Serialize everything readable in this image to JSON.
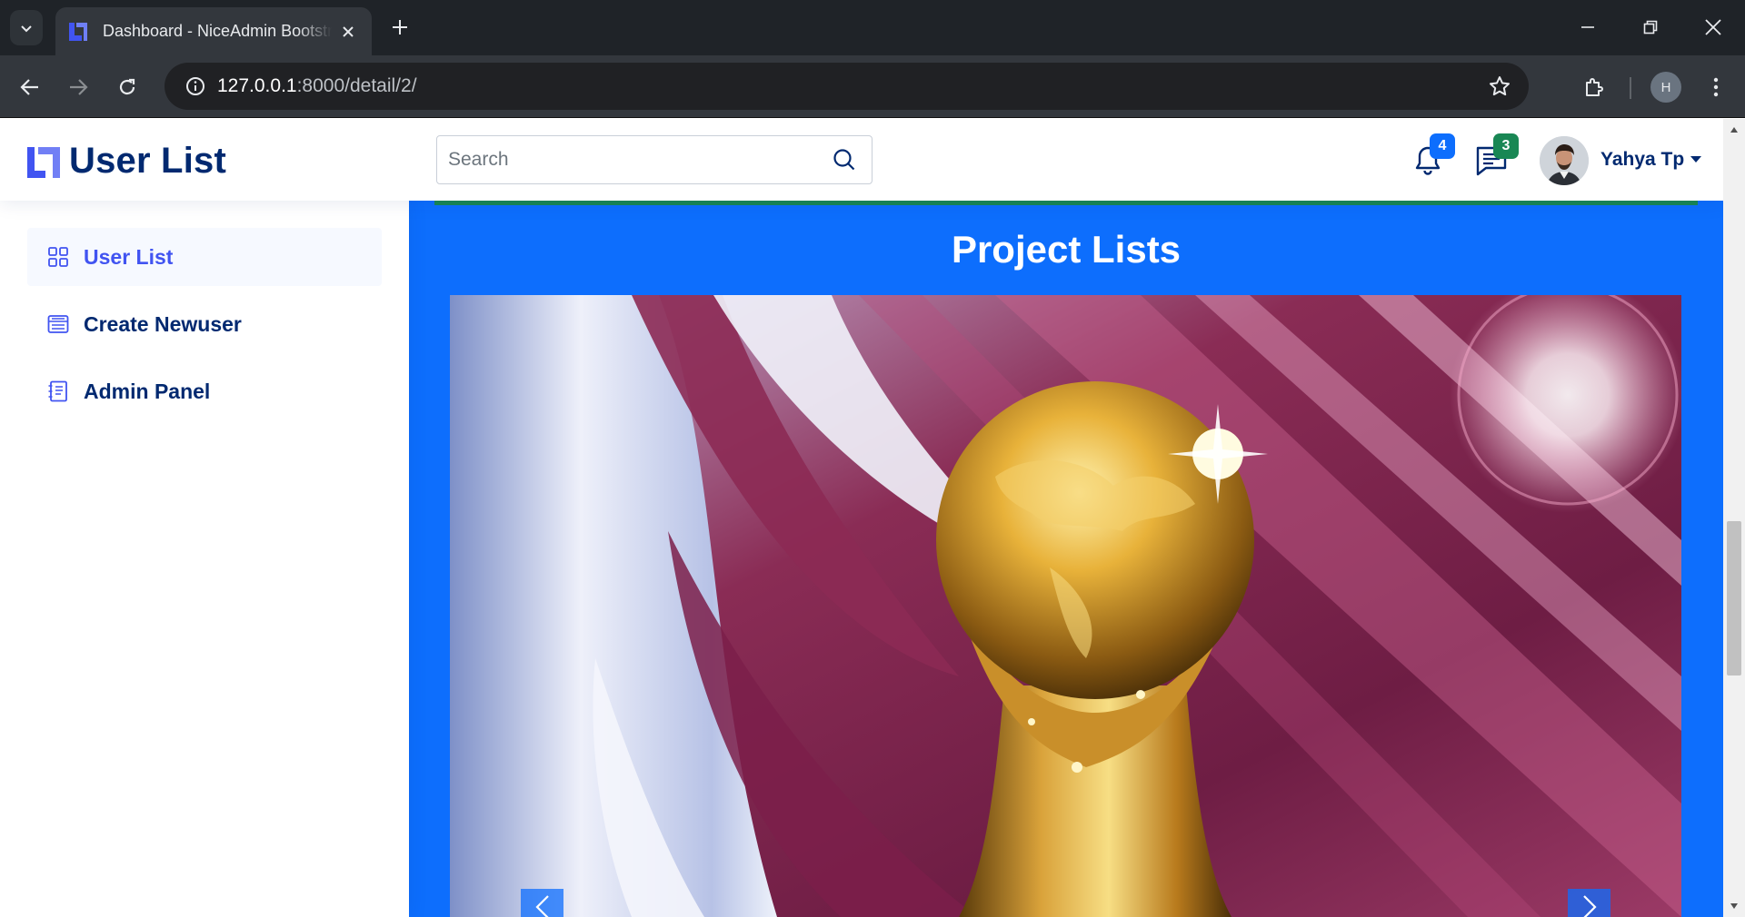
{
  "browser": {
    "tab_title": "Dashboard - NiceAdmin Bootstrap Template",
    "url_host": "127.0.0.1",
    "url_path": ":8000/detail/2/",
    "profile_initial": "H"
  },
  "header": {
    "logo_text": "User List",
    "search_placeholder": "Search",
    "notifications_count": "4",
    "messages_count": "3",
    "profile_name": "Yahya Tp"
  },
  "sidebar": {
    "items": [
      {
        "label": "User List",
        "icon": "grid-icon",
        "active": true
      },
      {
        "label": "Create Newuser",
        "icon": "menu-button-icon",
        "active": false
      },
      {
        "label": "Admin Panel",
        "icon": "journal-text-icon",
        "active": false
      }
    ]
  },
  "main": {
    "title": "Project Lists",
    "carousel_image": "world-cup-trophy-with-qatar-flag"
  },
  "colors": {
    "brand": "#012970",
    "accent": "#4154f1",
    "main_bg": "#0d6efd",
    "badge_primary": "#0d6efd",
    "badge_success": "#198754"
  }
}
